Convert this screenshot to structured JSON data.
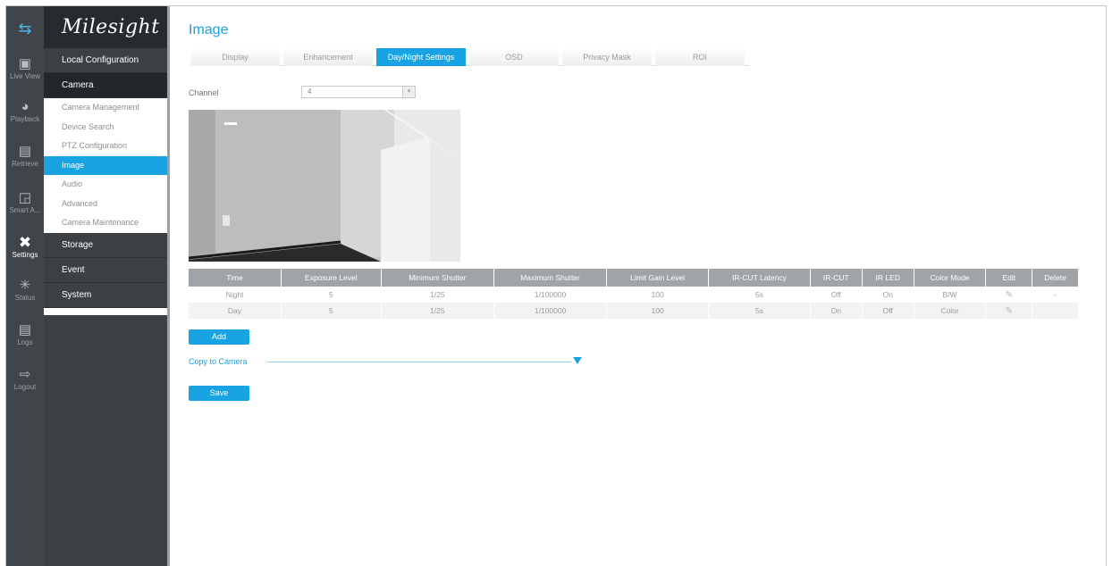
{
  "rail": {
    "items": [
      {
        "label": "Live View",
        "icon": "monitor-icon"
      },
      {
        "label": "Playback",
        "icon": "playback-icon"
      },
      {
        "label": "Retrieve",
        "icon": "retrieve-icon"
      },
      {
        "label": "Smart A...",
        "icon": "smart-analysis-icon"
      },
      {
        "label": "Settings",
        "icon": "settings-icon"
      },
      {
        "label": "Status",
        "icon": "status-icon"
      },
      {
        "label": "Logs",
        "icon": "logs-icon"
      },
      {
        "label": "Logout",
        "icon": "logout-icon"
      }
    ]
  },
  "menu": {
    "logo": "Milesight",
    "local_config": "Local Configuration",
    "camera": "Camera",
    "camera_items": [
      "Camera Management",
      "Device Search",
      "PTZ Configuration",
      "Image",
      "Audio",
      "Advanced",
      "Camera Maintenance"
    ],
    "storage": "Storage",
    "event": "Event",
    "system": "System"
  },
  "page": {
    "title": "Image",
    "tabs": [
      "Display",
      "Enhancement",
      "Day/Night Settings",
      "OSD",
      "Privacy Mask",
      "ROI"
    ],
    "active_tab": "Day/Night Settings",
    "channel_label": "Channel",
    "channel_value": "4",
    "accent": "#1aa3e2"
  },
  "table": {
    "headers": [
      "Time",
      "Exposure Level",
      "Minimum Shutter",
      "Maximum Shutter",
      "Limit Gain Level",
      "IR-CUT Latency",
      "IR-CUT",
      "IR LED",
      "Color Mode",
      "Edit",
      "Delete"
    ],
    "rows": [
      [
        "Night",
        "5",
        "1/25",
        "1/100000",
        "100",
        "5s",
        "Off",
        "On",
        "B/W",
        "",
        "-"
      ],
      [
        "Day",
        "5",
        "1/25",
        "1/100000",
        "100",
        "5s",
        "On",
        "Off",
        "Color",
        "",
        ""
      ]
    ]
  },
  "buttons": {
    "add": "Add",
    "save": "Save"
  },
  "copy_to_camera": "Copy to Camera"
}
